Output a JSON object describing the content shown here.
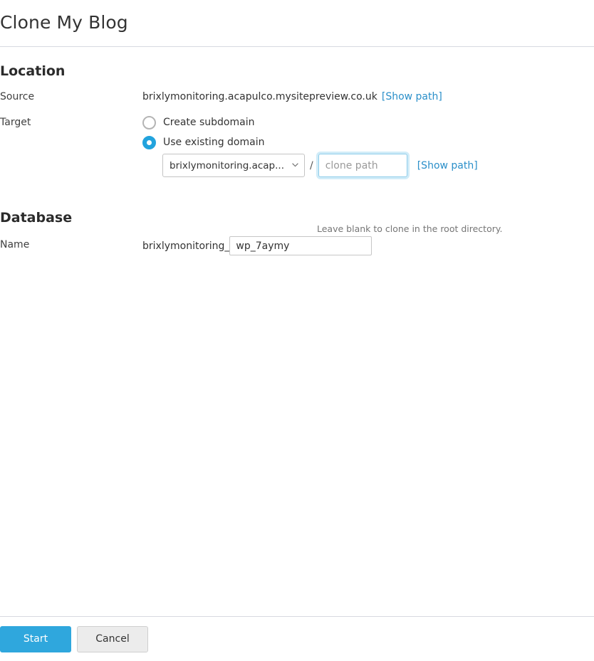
{
  "header": {
    "title": "Clone My Blog"
  },
  "location": {
    "heading": "Location",
    "source_label": "Source",
    "source_value": "brixlymonitoring.acapulco.mysitepreview.co.uk",
    "source_show_path_link": "[Show path]",
    "target_label": "Target",
    "radio_create_subdomain": "Create subdomain",
    "radio_use_existing_domain": "Use existing domain",
    "selected_option": "use_existing_domain",
    "domain_select_value": "brixlymonitoring.acap...",
    "domain_select_options": [
      "brixlymonitoring.acap..."
    ],
    "path_separator": "/",
    "clone_path_value": "",
    "clone_path_placeholder": "clone path",
    "target_show_path_link": "[Show path]",
    "helper_text": "Leave blank to clone in the root directory."
  },
  "database": {
    "heading": "Database",
    "name_label": "Name",
    "name_prefix": "brixlymonitoring_",
    "name_value": "wp_7aymy"
  },
  "footer": {
    "start_label": "Start",
    "cancel_label": "Cancel"
  },
  "icons": {
    "chevron_down": "chevron-down-icon"
  },
  "colors": {
    "accent_blue": "#2fa7dd",
    "link_blue": "#2a8fc9",
    "radio_selected": "#22a3dd",
    "border_gray": "#d7d9e0",
    "cancel_bg": "#ececec"
  }
}
